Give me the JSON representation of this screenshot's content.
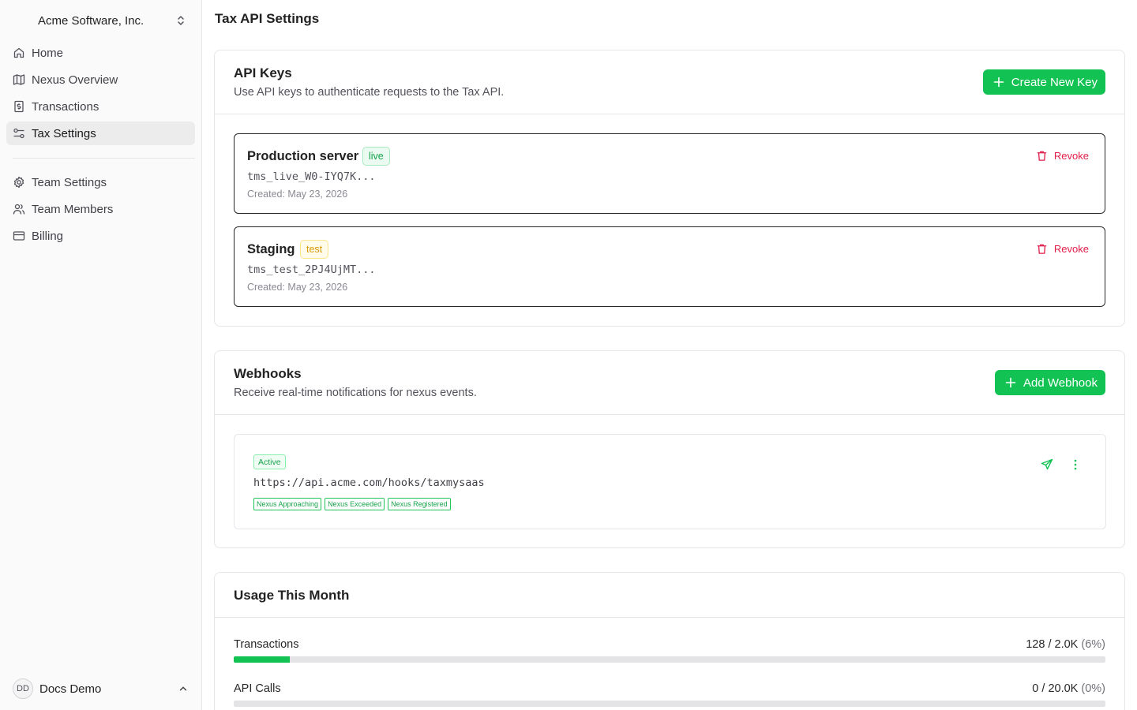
{
  "sidebar": {
    "org_name": "Acme Software, Inc.",
    "nav_primary": [
      {
        "label": "Home",
        "icon": "home-icon"
      },
      {
        "label": "Nexus Overview",
        "icon": "map-icon"
      },
      {
        "label": "Transactions",
        "icon": "receipt-icon"
      },
      {
        "label": "Tax Settings",
        "icon": "sliders-icon",
        "active": true
      }
    ],
    "nav_secondary": [
      {
        "label": "Team Settings",
        "icon": "gear-icon"
      },
      {
        "label": "Team Members",
        "icon": "users-icon"
      },
      {
        "label": "Billing",
        "icon": "credit-card-icon"
      }
    ],
    "user": {
      "initials": "DD",
      "name": "Docs Demo"
    }
  },
  "page": {
    "title": "Tax API Settings"
  },
  "api_keys": {
    "title": "API Keys",
    "description": "Use API keys to authenticate requests to the Tax API.",
    "create_label": "Create New Key",
    "keys": [
      {
        "name": "Production server",
        "env": "live",
        "token": "tms_live_W0-IYQ7K...",
        "created": "Created: May 23, 2026",
        "revoke_label": "Revoke"
      },
      {
        "name": "Staging",
        "env": "test",
        "token": "tms_test_2PJ4UjMT...",
        "created": "Created: May 23, 2026",
        "revoke_label": "Revoke"
      }
    ]
  },
  "webhooks": {
    "title": "Webhooks",
    "description": "Receive real-time notifications for nexus events.",
    "add_label": "Add Webhook",
    "items": [
      {
        "status": "Active",
        "url": "https://api.acme.com/hooks/taxmysaas",
        "events": [
          "Nexus Approaching",
          "Nexus Exceeded",
          "Nexus Registered"
        ]
      }
    ]
  },
  "usage": {
    "title": "Usage This Month",
    "meters": [
      {
        "label": "Transactions",
        "value": "128 / 2.0K",
        "percent_label": "(6%)",
        "fraction": 0.064
      },
      {
        "label": "API Calls",
        "value": "0 / 20.0K",
        "percent_label": "(0%)",
        "fraction": 0
      }
    ]
  },
  "colors": {
    "accent": "#12c253",
    "danger": "#e11d48",
    "live": "#14a34b",
    "test": "#d99a06"
  }
}
